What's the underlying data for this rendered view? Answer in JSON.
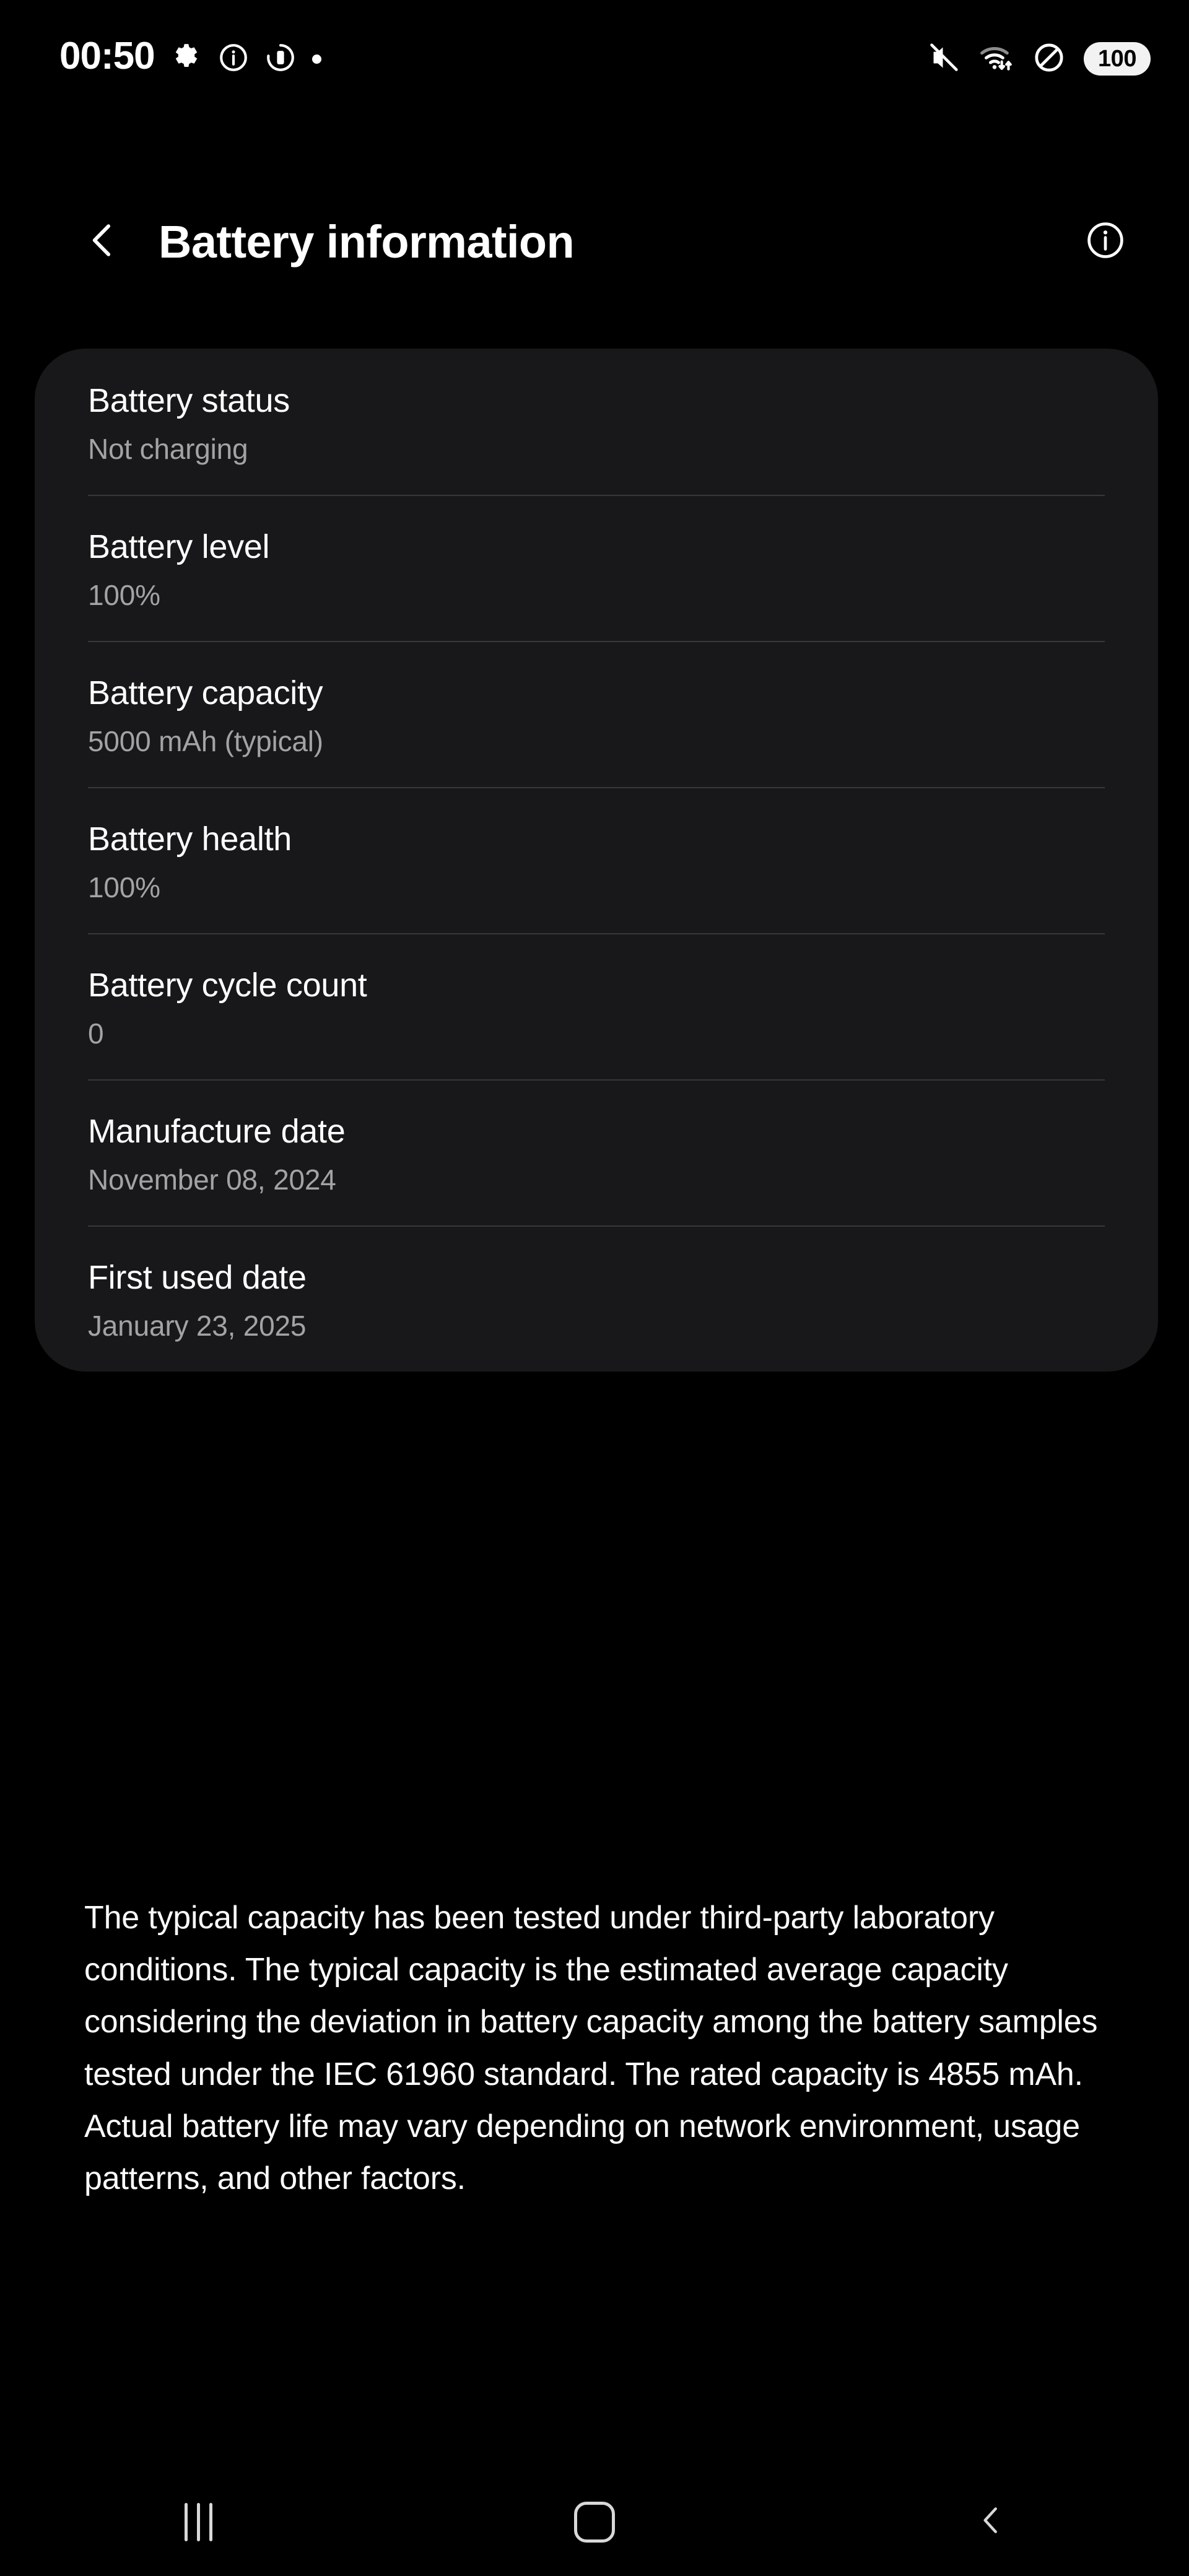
{
  "status_bar": {
    "time": "00:50",
    "left_icons": [
      "gear-icon",
      "info-circle-icon",
      "battery-circle-icon",
      "dot-icon"
    ],
    "right_icons": [
      "mute-icon",
      "wifi-data-icon",
      "do-not-disturb-icon"
    ],
    "battery_percent": "100"
  },
  "header": {
    "back_icon": "chevron-left-icon",
    "title": "Battery information",
    "info_icon": "info-circle-icon"
  },
  "card": {
    "rows": [
      {
        "label": "Battery status",
        "value": "Not charging"
      },
      {
        "label": "Battery level",
        "value": "100%"
      },
      {
        "label": "Battery capacity",
        "value": "5000 mAh (typical)"
      },
      {
        "label": "Battery health",
        "value": "100%"
      },
      {
        "label": "Battery cycle count",
        "value": "0"
      },
      {
        "label": "Manufacture date",
        "value": "November 08, 2024"
      },
      {
        "label": "First used date",
        "value": "January 23, 2025"
      }
    ]
  },
  "footnote": {
    "text": "The typical capacity has been tested under third-party laboratory conditions. The typical capacity is the estimated average capacity considering the deviation in battery capacity among the battery samples tested under the IEC 61960 standard. The rated capacity is 4855 mAh. Actual battery life may vary depending on network environment, usage patterns, and other factors."
  },
  "nav_bar": {
    "recents_label": "recents-icon",
    "home_label": "home-icon",
    "back_label": "back-icon"
  },
  "colors": {
    "background": "#000000",
    "card": "#18181a",
    "divider": "#38383a",
    "primary_text": "#ffffff",
    "secondary_text": "#a3a3a6",
    "nav_icon": "#d8d8d8",
    "battery_pill": "#f2f2f2"
  }
}
